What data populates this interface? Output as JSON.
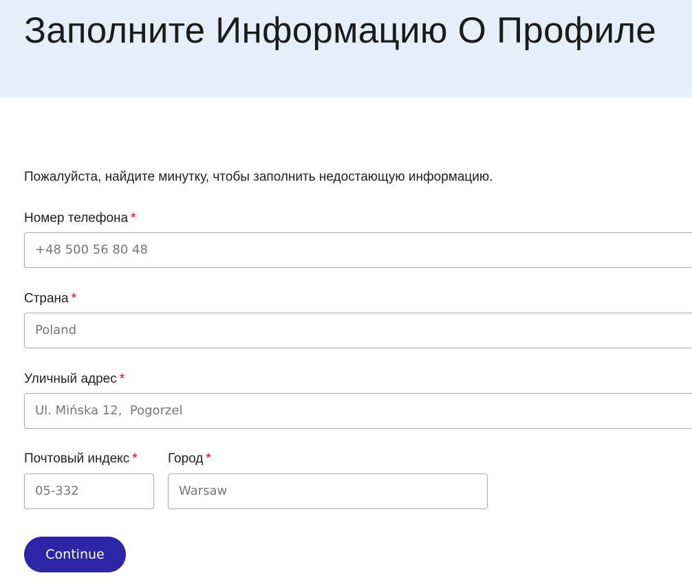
{
  "header": {
    "title": "Заполните Информацию О Профиле",
    "background_color": "#e4effa"
  },
  "form": {
    "intro": "Пожалуйста, найдите минутку, чтобы заполнить недостающую информацию.",
    "required_marker": "*",
    "phone": {
      "label": "Номер телефона",
      "value": "+48 500 56 80 48"
    },
    "country": {
      "label": "Страна",
      "value": "Poland"
    },
    "street": {
      "label": "Уличный адрес",
      "value": "Ul. Mińska 12,  Pogorzel"
    },
    "postal_code": {
      "label": "Почтовый индекс",
      "value": "05-332"
    },
    "city": {
      "label": "Город",
      "value": "Warsaw"
    },
    "submit_label": "Continue"
  },
  "colors": {
    "accent": "#2b26a6",
    "required": "#e3001b"
  }
}
